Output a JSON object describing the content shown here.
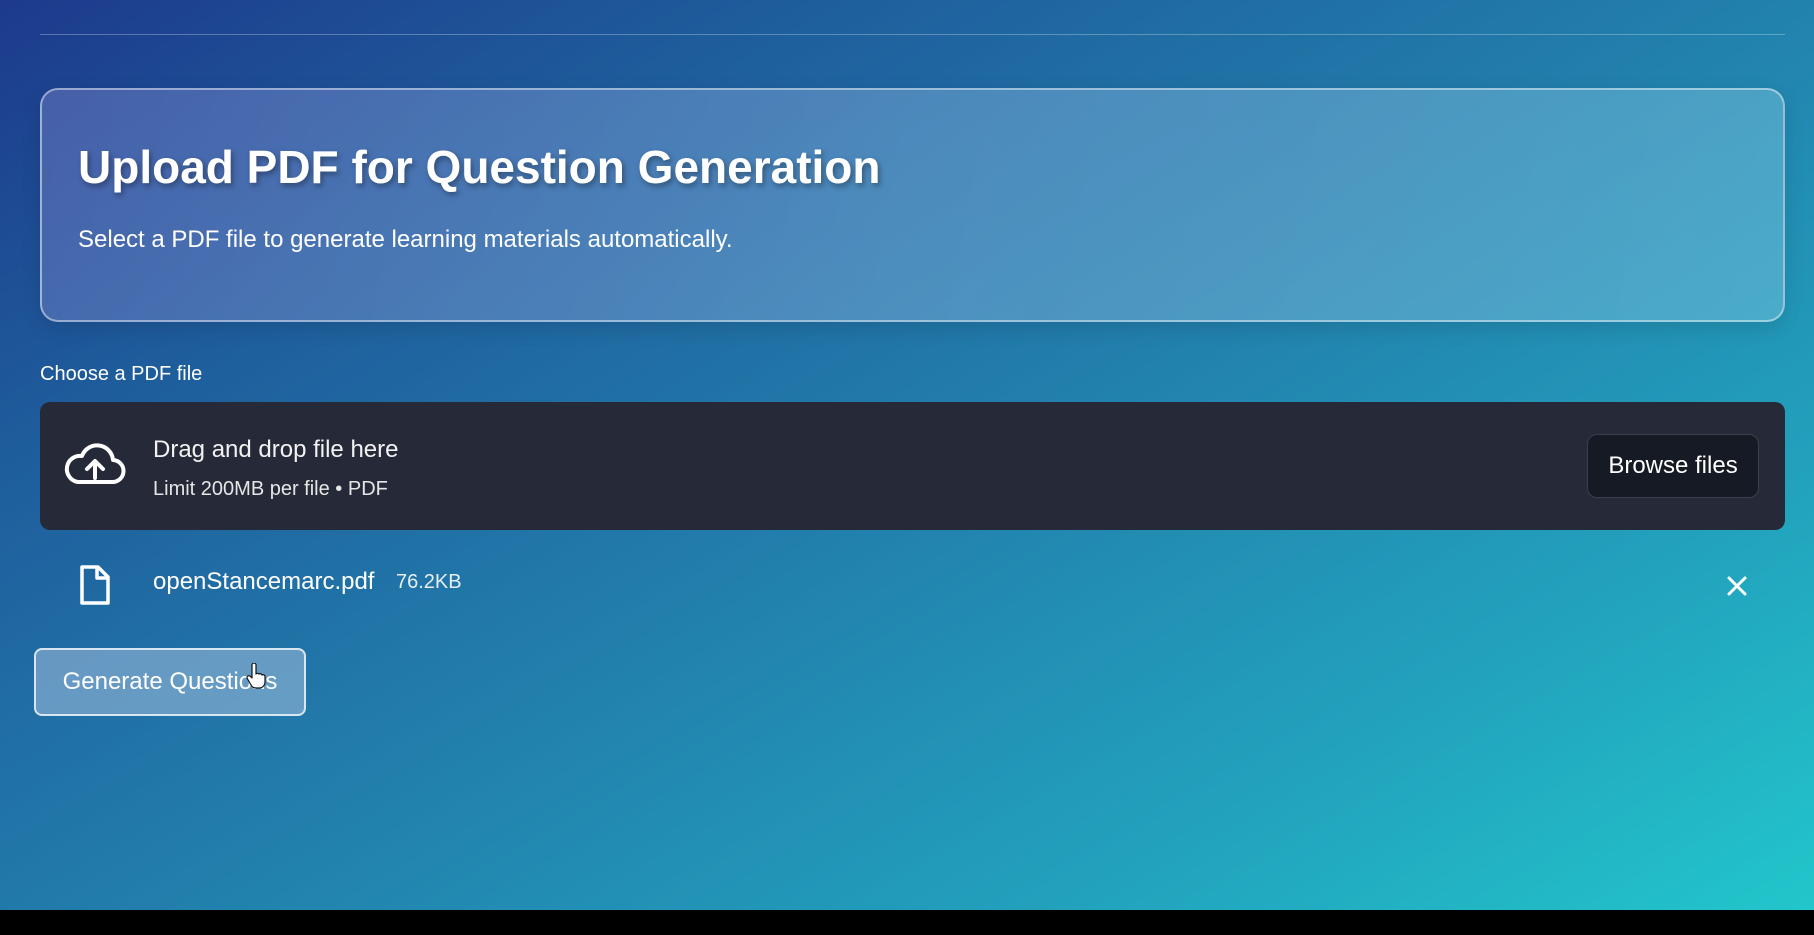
{
  "hero": {
    "title": "Upload PDF for Question Generation",
    "subtitle": "Select a PDF file to generate learning materials automatically."
  },
  "uploader": {
    "label": "Choose a PDF file",
    "drop_text": "Drag and drop file here",
    "limit_text": "Limit 200MB per file • PDF",
    "browse_label": "Browse files",
    "icon": "cloud-upload-icon"
  },
  "uploaded_file": {
    "name": "openStancemarc.pdf",
    "size": "76.2KB",
    "icon": "file-icon",
    "remove_icon": "close-icon"
  },
  "actions": {
    "generate_label": "Generate Questions"
  }
}
